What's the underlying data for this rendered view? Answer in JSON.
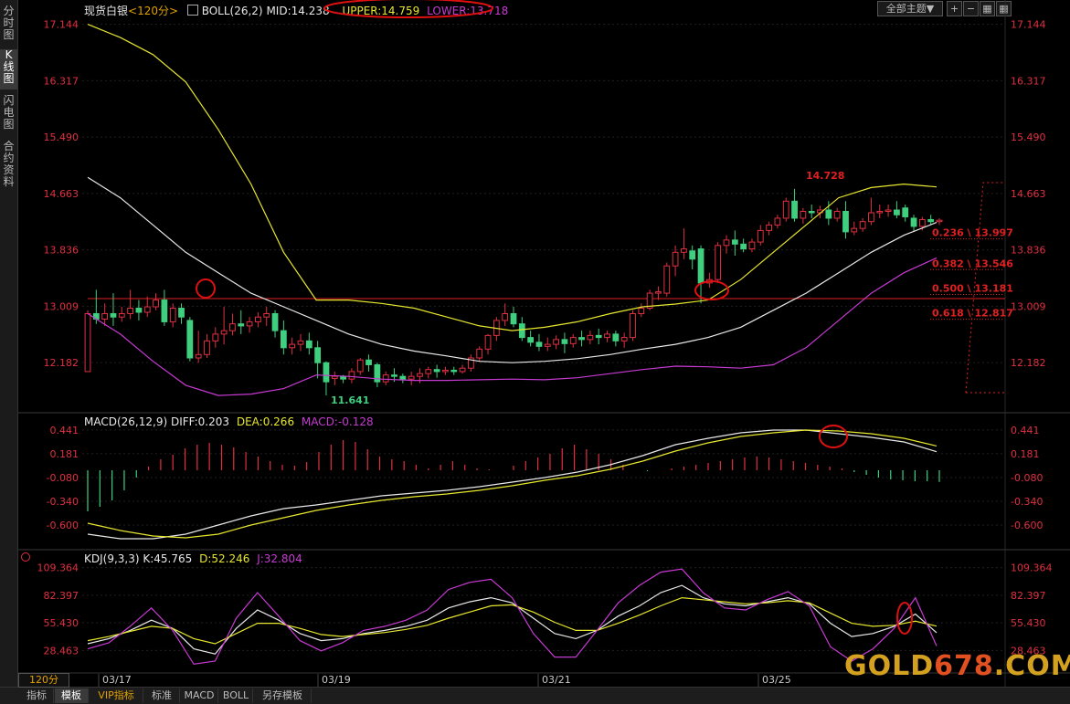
{
  "sidebar": {
    "tabs": [
      "分时图",
      "K线图",
      "闪电图",
      "合约资料"
    ],
    "active": 1
  },
  "top_controls": {
    "template_select": "全部主题▼"
  },
  "main_panel": {
    "symbol": "现货白银",
    "period": "<120分>",
    "indicator": "BOLL(26,2)",
    "mid": "MID:14.238",
    "upper": "UPPER:14.759",
    "lower": "LOWER:13.718"
  },
  "macd_panel": {
    "name": "MACD(26,12,9)",
    "diff": "DIFF:0.203",
    "dea": "DEA:0.266",
    "macd": "MACD:-0.128"
  },
  "kdj_panel": {
    "name": "KDJ(9,3,3)",
    "k": "K:45.765",
    "d": "D:52.246",
    "j": "J:32.804"
  },
  "bottom_bar": {
    "period": "120分",
    "tabs": [
      "指标",
      "模板",
      "VIP指标",
      "标准",
      "MACD",
      "BOLL",
      "另存模板"
    ],
    "active_tab": 1
  },
  "watermark": {
    "part1": "GOLD",
    "part2": "678",
    "part3": ".COM"
  },
  "colors": {
    "up": "#e03040",
    "down": "#3fcf7f",
    "mid_line": "#e8e8e8",
    "upper_line": "#e6e62e",
    "lower_line": "#c73ad2",
    "grid": "#202020",
    "axis_text": "#e03040",
    "price_line": "#e02020"
  },
  "chart_data": [
    {
      "type": "candlestick",
      "title": "现货白银 BOLL(26,2)",
      "yticks": [
        "17.144",
        "16.317",
        "15.490",
        "14.663",
        "13.836",
        "13.009",
        "12.182"
      ],
      "ylim": [
        11.5,
        17.3
      ],
      "xticks": [
        "03/17",
        "03/19",
        "03/21",
        "03/25"
      ],
      "annotations": {
        "high": "14.728",
        "low": "11.641"
      },
      "fib_levels": [
        {
          "label": "0.236 \\ 13.997",
          "value": 13.997
        },
        {
          "label": "0.382 \\ 13.546",
          "value": 13.546
        },
        {
          "label": "0.500 \\ 13.181",
          "value": 13.181
        },
        {
          "label": "0.618 \\ 12.817",
          "value": 12.817
        }
      ],
      "horizontal_line": 13.12,
      "candles": [
        [
          12.05,
          12.95,
          12.9,
          12.05
        ],
        [
          12.9,
          13.25,
          12.82,
          12.75
        ],
        [
          12.82,
          13.05,
          12.9,
          12.72
        ],
        [
          12.9,
          13.2,
          12.85,
          12.72
        ],
        [
          12.85,
          13.0,
          12.9,
          12.78
        ],
        [
          12.9,
          13.25,
          12.98,
          12.82
        ],
        [
          12.98,
          13.1,
          12.92,
          12.8
        ],
        [
          12.92,
          13.15,
          13.0,
          12.85
        ],
        [
          13.0,
          13.2,
          13.1,
          12.95
        ],
        [
          13.1,
          13.25,
          12.78,
          12.72
        ],
        [
          12.78,
          13.05,
          12.98,
          12.7
        ],
        [
          12.98,
          13.05,
          12.85,
          12.75
        ],
        [
          12.8,
          12.85,
          12.25,
          12.2
        ],
        [
          12.25,
          12.65,
          12.3,
          12.18
        ],
        [
          12.3,
          12.6,
          12.5,
          12.25
        ],
        [
          12.5,
          12.7,
          12.6,
          12.4
        ],
        [
          12.6,
          13.0,
          12.65,
          12.45
        ],
        [
          12.65,
          12.9,
          12.75,
          12.58
        ],
        [
          12.75,
          12.95,
          12.72,
          12.6
        ],
        [
          12.72,
          12.85,
          12.78,
          12.62
        ],
        [
          12.78,
          12.92,
          12.85,
          12.7
        ],
        [
          12.85,
          13.0,
          12.9,
          12.72
        ],
        [
          12.9,
          12.95,
          12.65,
          12.55
        ],
        [
          12.65,
          12.8,
          12.4,
          12.3
        ],
        [
          12.4,
          12.55,
          12.45,
          12.3
        ],
        [
          12.45,
          12.6,
          12.5,
          12.35
        ],
        [
          12.5,
          12.62,
          12.4,
          12.3
        ],
        [
          12.4,
          12.5,
          12.18,
          11.95
        ],
        [
          12.18,
          12.2,
          11.9,
          11.7
        ],
        [
          11.95,
          12.05,
          11.98,
          11.85
        ],
        [
          11.98,
          12.0,
          11.94,
          11.88
        ],
        [
          11.94,
          12.1,
          12.05,
          11.88
        ],
        [
          12.05,
          12.25,
          12.22,
          12.0
        ],
        [
          12.22,
          12.3,
          12.15,
          12.05
        ],
        [
          12.15,
          12.18,
          11.9,
          11.82
        ],
        [
          11.9,
          12.05,
          12.0,
          11.85
        ],
        [
          12.0,
          12.1,
          11.98,
          11.9
        ],
        [
          11.98,
          12.02,
          11.94,
          11.88
        ],
        [
          11.94,
          12.05,
          11.98,
          11.85
        ],
        [
          11.98,
          12.1,
          12.02,
          11.88
        ],
        [
          12.02,
          12.12,
          12.08,
          11.95
        ],
        [
          12.08,
          12.15,
          12.05,
          11.96
        ],
        [
          12.05,
          12.12,
          12.07,
          12.0
        ],
        [
          12.07,
          12.12,
          12.05,
          12.0
        ],
        [
          12.05,
          12.15,
          12.1,
          12.02
        ],
        [
          12.1,
          12.3,
          12.25,
          12.05
        ],
        [
          12.25,
          12.42,
          12.38,
          12.2
        ],
        [
          12.38,
          12.6,
          12.58,
          12.3
        ],
        [
          12.58,
          12.85,
          12.8,
          12.5
        ],
        [
          12.8,
          13.05,
          12.9,
          12.72
        ],
        [
          12.9,
          13.0,
          12.75,
          12.7
        ],
        [
          12.75,
          12.85,
          12.55,
          12.5
        ],
        [
          12.55,
          12.65,
          12.48,
          12.42
        ],
        [
          12.48,
          12.6,
          12.42,
          12.35
        ],
        [
          12.42,
          12.55,
          12.45,
          12.35
        ],
        [
          12.45,
          12.58,
          12.52,
          12.38
        ],
        [
          12.52,
          12.62,
          12.46,
          12.32
        ],
        [
          12.46,
          12.6,
          12.55,
          12.4
        ],
        [
          12.55,
          12.65,
          12.52,
          12.42
        ],
        [
          12.52,
          12.65,
          12.58,
          12.45
        ],
        [
          12.58,
          12.68,
          12.55,
          12.45
        ],
        [
          12.55,
          12.65,
          12.6,
          12.48
        ],
        [
          12.6,
          12.65,
          12.5,
          12.42
        ],
        [
          12.5,
          12.62,
          12.55,
          12.4
        ],
        [
          12.55,
          12.95,
          12.9,
          12.5
        ],
        [
          12.9,
          13.05,
          12.98,
          12.85
        ],
        [
          12.98,
          13.25,
          13.2,
          12.95
        ],
        [
          13.2,
          13.3,
          13.22,
          13.1
        ],
        [
          13.2,
          13.65,
          13.6,
          13.15
        ],
        [
          13.6,
          13.9,
          13.8,
          13.45
        ],
        [
          13.8,
          14.15,
          13.85,
          13.7
        ],
        [
          13.82,
          13.9,
          13.7,
          13.55
        ],
        [
          13.85,
          13.9,
          13.35,
          13.05
        ],
        [
          13.35,
          13.5,
          13.4,
          13.28
        ],
        [
          13.4,
          13.95,
          13.9,
          13.35
        ],
        [
          13.9,
          14.05,
          13.98,
          13.78
        ],
        [
          13.98,
          14.12,
          13.92,
          13.75
        ],
        [
          13.92,
          14.0,
          13.85,
          13.8
        ],
        [
          13.85,
          14.0,
          13.95,
          13.8
        ],
        [
          13.95,
          14.2,
          14.12,
          13.9
        ],
        [
          14.12,
          14.25,
          14.2,
          14.05
        ],
        [
          14.2,
          14.35,
          14.3,
          14.15
        ],
        [
          14.3,
          14.6,
          14.55,
          14.25
        ],
        [
          14.55,
          14.73,
          14.3,
          14.25
        ],
        [
          14.3,
          14.45,
          14.4,
          14.22
        ],
        [
          14.4,
          14.5,
          14.38,
          14.3
        ],
        [
          14.38,
          14.48,
          14.42,
          14.3
        ],
        [
          14.42,
          14.55,
          14.3,
          14.2
        ],
        [
          14.3,
          14.45,
          14.4,
          14.25
        ],
        [
          14.4,
          14.55,
          14.1,
          14.0
        ],
        [
          14.1,
          14.25,
          14.15,
          14.05
        ],
        [
          14.15,
          14.3,
          14.25,
          14.1
        ],
        [
          14.25,
          14.6,
          14.38,
          14.2
        ],
        [
          14.38,
          14.5,
          14.4,
          14.3
        ],
        [
          14.4,
          14.5,
          14.42,
          14.32
        ],
        [
          14.42,
          14.55,
          14.35,
          14.3
        ],
        [
          14.45,
          14.5,
          14.32,
          14.25
        ],
        [
          14.3,
          14.35,
          14.18,
          14.1
        ],
        [
          14.18,
          14.32,
          14.28,
          14.12
        ],
        [
          14.28,
          14.35,
          14.25,
          14.2
        ],
        [
          14.25,
          14.3,
          14.27,
          14.2
        ]
      ],
      "boll_upper": [
        17.144,
        16.95,
        16.7,
        16.3,
        15.6,
        14.8,
        13.8,
        13.1,
        13.1,
        13.05,
        12.98,
        12.85,
        12.72,
        12.65,
        12.7,
        12.78,
        12.9,
        13.0,
        13.04,
        13.1,
        13.4,
        13.8,
        14.2,
        14.6,
        14.75,
        14.8,
        14.759
      ],
      "boll_mid": [
        14.9,
        14.6,
        14.2,
        13.8,
        13.5,
        13.2,
        13.0,
        12.8,
        12.6,
        12.45,
        12.35,
        12.28,
        12.2,
        12.18,
        12.2,
        12.24,
        12.3,
        12.38,
        12.45,
        12.55,
        12.7,
        12.95,
        13.2,
        13.5,
        13.8,
        14.05,
        14.238
      ],
      "boll_lower": [
        12.9,
        12.6,
        12.2,
        11.85,
        11.7,
        11.72,
        11.8,
        12.0,
        11.98,
        11.94,
        11.92,
        11.92,
        11.93,
        11.94,
        11.93,
        11.96,
        12.02,
        12.08,
        12.13,
        12.12,
        12.1,
        12.15,
        12.4,
        12.8,
        13.2,
        13.5,
        13.718
      ]
    },
    {
      "type": "bar_line",
      "title": "MACD(26,12,9)",
      "yticks": [
        "0.441",
        "0.181",
        "-0.080",
        "-0.340",
        "-0.600"
      ],
      "ylim": [
        -0.8,
        0.55
      ],
      "series": [
        {
          "name": "DIFF",
          "values": [
            -0.7,
            -0.75,
            -0.75,
            -0.7,
            -0.6,
            -0.5,
            -0.42,
            -0.38,
            -0.33,
            -0.28,
            -0.25,
            -0.22,
            -0.18,
            -0.13,
            -0.08,
            -0.02,
            0.06,
            0.16,
            0.28,
            0.35,
            0.41,
            0.44,
            0.44,
            0.4,
            0.36,
            0.31,
            0.203
          ]
        },
        {
          "name": "DEA",
          "values": [
            -0.58,
            -0.66,
            -0.72,
            -0.74,
            -0.7,
            -0.6,
            -0.52,
            -0.44,
            -0.38,
            -0.33,
            -0.29,
            -0.26,
            -0.22,
            -0.17,
            -0.11,
            -0.06,
            0.01,
            0.1,
            0.21,
            0.3,
            0.37,
            0.41,
            0.44,
            0.43,
            0.4,
            0.35,
            0.266
          ]
        },
        {
          "name": "MACD",
          "values": [
            -0.45,
            -0.4,
            -0.33,
            -0.22,
            -0.08,
            0.04,
            0.12,
            0.17,
            0.24,
            0.28,
            0.3,
            0.28,
            0.25,
            0.2,
            0.15,
            0.1,
            0.06,
            0.05,
            0.09,
            0.2,
            0.28,
            0.33,
            0.31,
            0.23,
            0.15,
            0.12,
            0.1,
            0.06,
            0.02,
            0.06,
            0.1,
            0.06,
            0.02,
            0.01,
            0.0,
            0.05,
            0.1,
            0.14,
            0.18,
            0.24,
            0.28,
            0.23,
            0.18,
            0.12,
            0.06,
            0.0,
            -0.01,
            0.0,
            0.02,
            0.04,
            0.06,
            0.08,
            0.1,
            0.12,
            0.14,
            0.15,
            0.14,
            0.12,
            0.1,
            0.08,
            0.06,
            0.04,
            0.02,
            -0.02,
            -0.05,
            -0.08,
            -0.1,
            -0.11,
            -0.12,
            -0.12,
            -0.128
          ]
        }
      ]
    },
    {
      "type": "line",
      "title": "KDJ(9,3,3)",
      "yticks": [
        "109.364",
        "82.397",
        "55.430",
        "28.463"
      ],
      "ylim": [
        10,
        118
      ],
      "series": [
        {
          "name": "K",
          "values": [
            35,
            40,
            48,
            58,
            50,
            30,
            25,
            50,
            68,
            58,
            45,
            38,
            40,
            45,
            48,
            52,
            58,
            70,
            76,
            80,
            75,
            60,
            45,
            40,
            48,
            62,
            72,
            85,
            92,
            80,
            74,
            72,
            76,
            80,
            74,
            55,
            42,
            45,
            52,
            64,
            45.765
          ]
        },
        {
          "name": "D",
          "values": [
            38,
            42,
            47,
            52,
            50,
            40,
            35,
            45,
            55,
            55,
            50,
            44,
            42,
            44,
            46,
            49,
            53,
            60,
            66,
            72,
            73,
            66,
            56,
            48,
            48,
            55,
            63,
            72,
            80,
            78,
            76,
            74,
            75,
            77,
            75,
            65,
            55,
            52,
            53,
            57,
            52.246
          ]
        },
        {
          "name": "J",
          "values": [
            30,
            36,
            52,
            70,
            48,
            15,
            18,
            60,
            85,
            62,
            38,
            28,
            36,
            48,
            52,
            58,
            68,
            88,
            95,
            98,
            80,
            45,
            22,
            22,
            48,
            75,
            92,
            105,
            108,
            85,
            70,
            68,
            78,
            86,
            72,
            32,
            18,
            30,
            50,
            80,
            32.804
          ]
        }
      ]
    }
  ]
}
